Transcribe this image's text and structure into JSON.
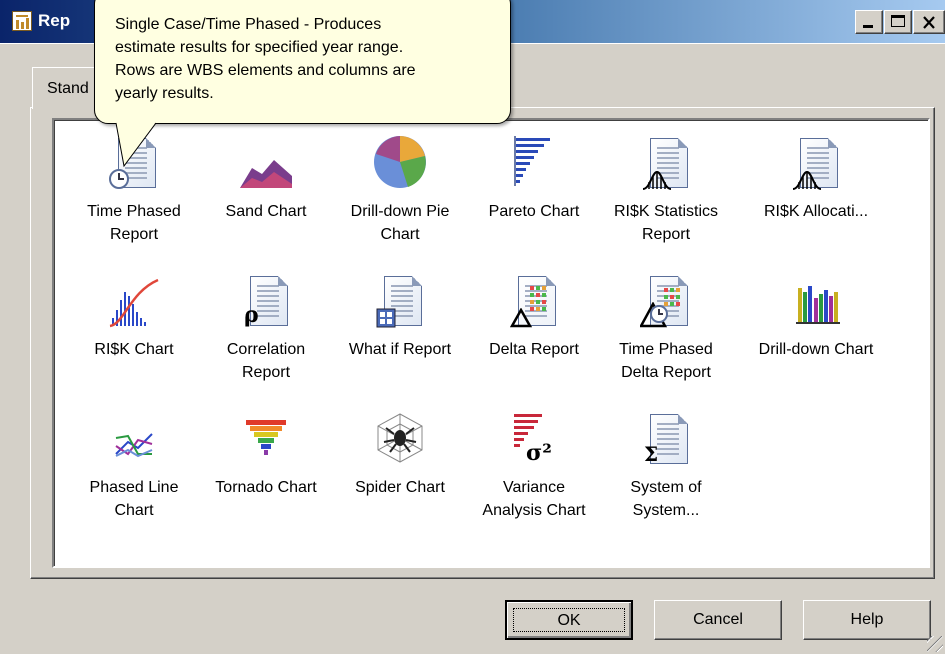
{
  "window": {
    "title": "Rep",
    "accent": "#0a246a"
  },
  "tooltip": {
    "lines": [
      "Single Case/Time Phased - Produces",
      "estimate results for specified year range.",
      "Rows are WBS elements and columns are",
      "yearly results."
    ]
  },
  "tab": {
    "label": "Stand"
  },
  "reports": [
    {
      "label": "Time Phased Report",
      "icon": "time-phased-report-icon"
    },
    {
      "label": "Sand Chart",
      "icon": "sand-chart-icon"
    },
    {
      "label": "Drill-down Pie Chart",
      "icon": "pie-chart-icon"
    },
    {
      "label": "Pareto Chart",
      "icon": "pareto-chart-icon"
    },
    {
      "label": "RI$K Statistics Report",
      "icon": "risk-statistics-report-icon"
    },
    {
      "label": "RI$K Allocati...",
      "icon": "risk-allocation-icon"
    },
    {
      "label": "RI$K Chart",
      "icon": "risk-chart-icon"
    },
    {
      "label": "Correlation Report",
      "icon": "correlation-report-icon"
    },
    {
      "label": "What if Report",
      "icon": "what-if-report-icon"
    },
    {
      "label": "Delta Report",
      "icon": "delta-report-icon"
    },
    {
      "label": "Time Phased Delta Report",
      "icon": "time-phased-delta-report-icon"
    },
    {
      "label": "Drill-down Chart",
      "icon": "drill-down-chart-icon"
    },
    {
      "label": "Phased Line Chart",
      "icon": "phased-line-chart-icon"
    },
    {
      "label": "Tornado Chart",
      "icon": "tornado-chart-icon"
    },
    {
      "label": "Spider Chart",
      "icon": "spider-chart-icon"
    },
    {
      "label": "Variance Analysis Chart",
      "icon": "variance-analysis-chart-icon"
    },
    {
      "label": "System of System...",
      "icon": "system-of-systems-icon"
    }
  ],
  "buttons": {
    "ok": "OK",
    "cancel": "Cancel",
    "help": "Help"
  }
}
